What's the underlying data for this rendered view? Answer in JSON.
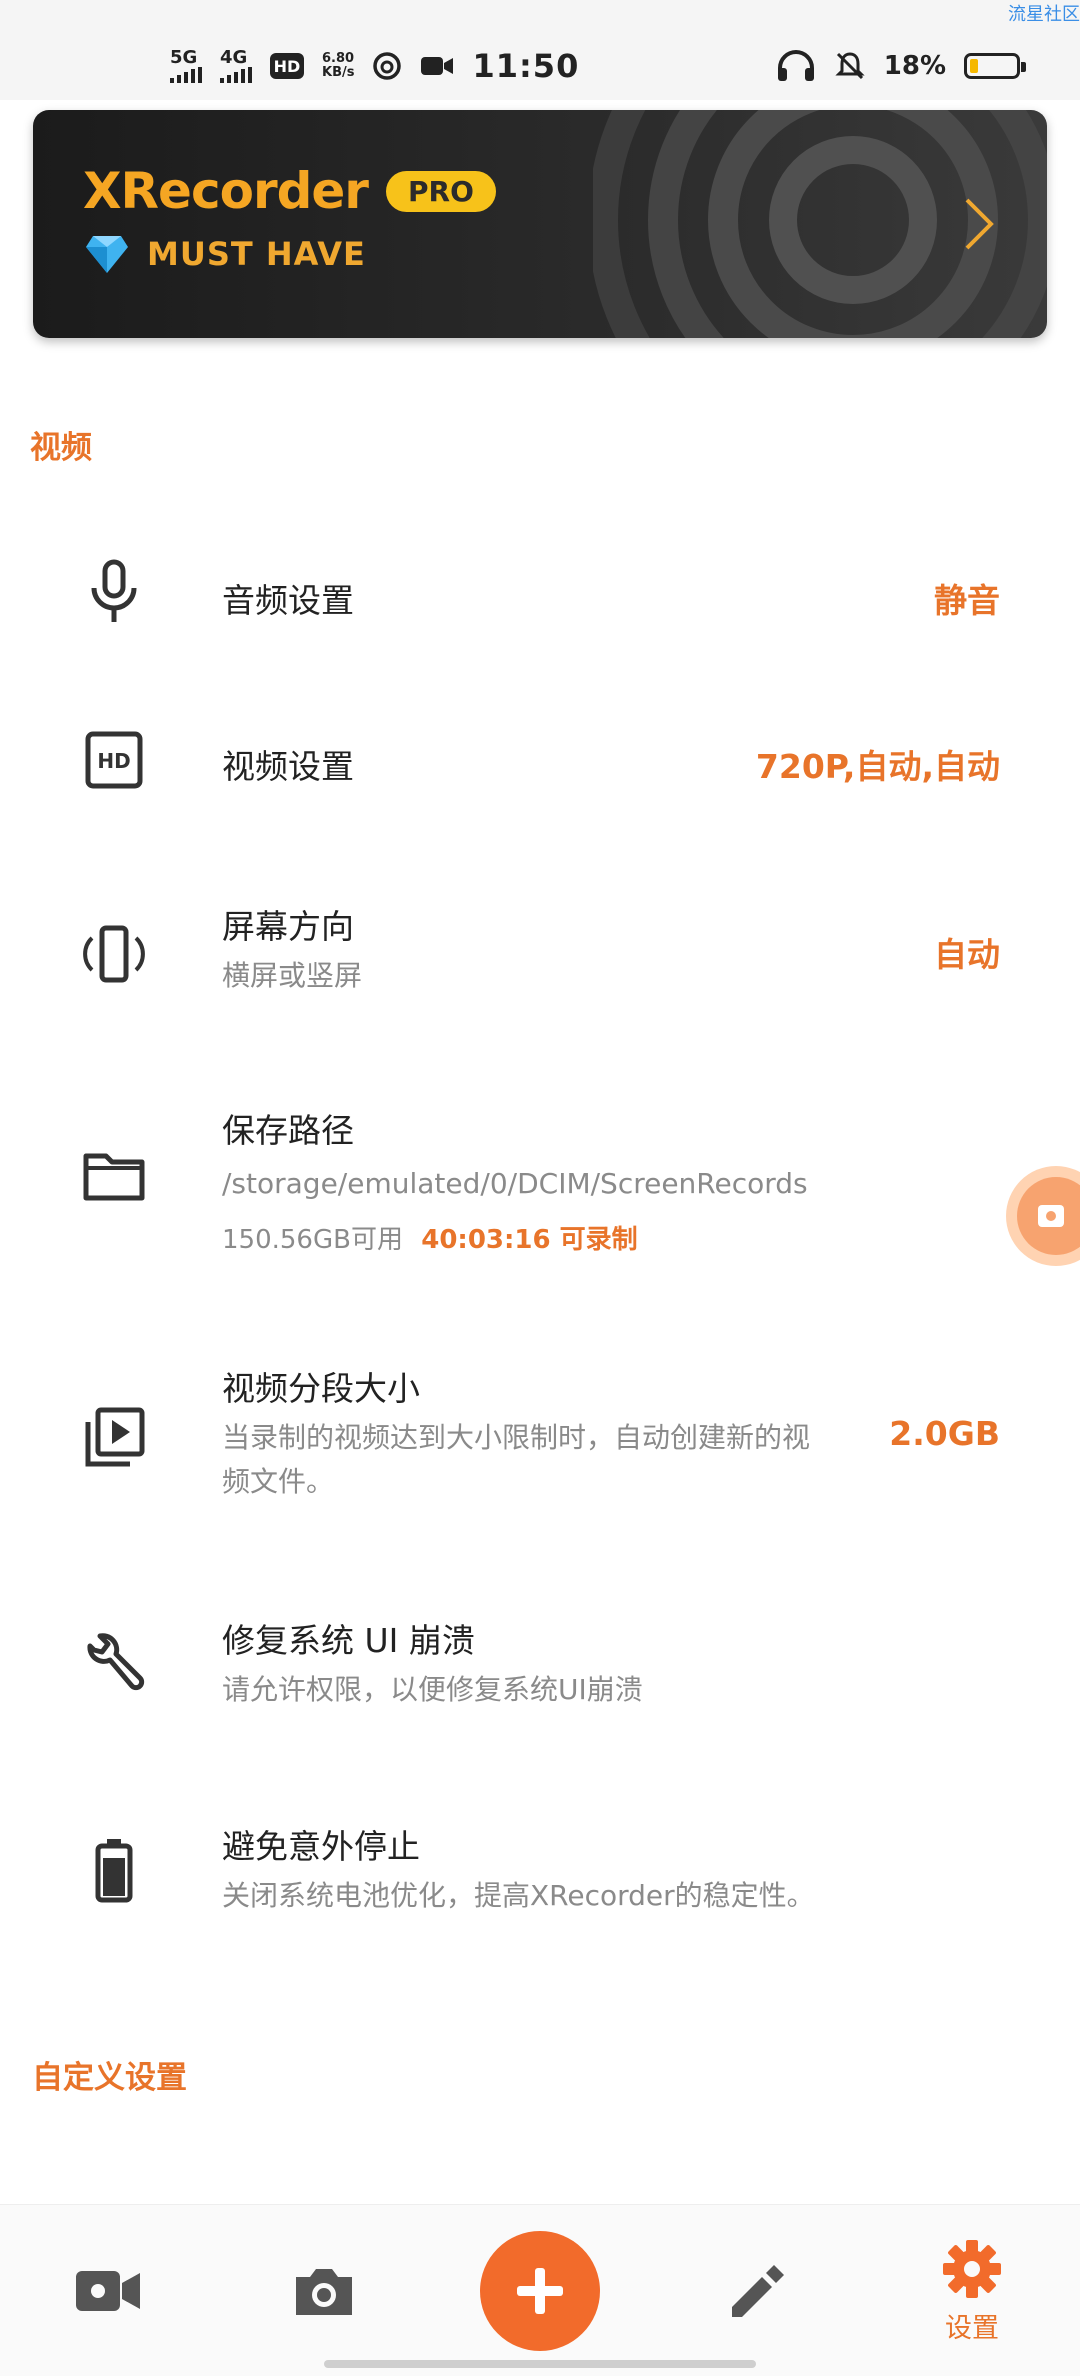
{
  "status_bar": {
    "net1": "5G",
    "net2": "4G",
    "hd": "HD",
    "speed_value": "6.80",
    "speed_unit": "KB/s",
    "time": "11:50",
    "battery_pct": "18%",
    "battery_level": 0.18,
    "corner_text": "流星社区"
  },
  "banner": {
    "brand": "XRecorder",
    "pro": "PRO",
    "tagline": "MUST HAVE"
  },
  "sections": {
    "video": "视频",
    "custom": "自定义设置"
  },
  "rows": {
    "audio": {
      "title": "音频设置",
      "value": "静音",
      "icon": "microphone-icon"
    },
    "video": {
      "title": "视频设置",
      "value": "720P,自动,自动",
      "icon": "hd-icon"
    },
    "orientation": {
      "title": "屏幕方向",
      "sub": "横屏或竖屏",
      "value": "自动",
      "icon": "screen-rotation-icon"
    },
    "save_path": {
      "title": "保存路径",
      "path": "/storage/emulated/0/DCIM/ScreenRecords",
      "free": "150.56GB可用",
      "record_time": "40:03:16 可录制",
      "icon": "folder-icon"
    },
    "segment": {
      "title": "视频分段大小",
      "sub_line1": "当录制的视频达到大小限制时，自动创建新的视",
      "sub_line2": "频文件。",
      "value": "2.0GB",
      "icon": "video-library-icon"
    },
    "fix_ui": {
      "title": "修复系统 UI 崩溃",
      "sub": "请允许权限，以便修复系统UI崩溃",
      "icon": "wrench-icon"
    },
    "avoid_stop": {
      "title": "避免意外停止",
      "sub": "关闭系统电池优化，提高XRecorder的稳定性。",
      "icon": "battery-icon"
    }
  },
  "bottom_nav": {
    "settings_label": "设置"
  },
  "colors": {
    "accent": "#e8742a",
    "fab": "#f26b2b",
    "pro_pill": "#f7c21a"
  }
}
